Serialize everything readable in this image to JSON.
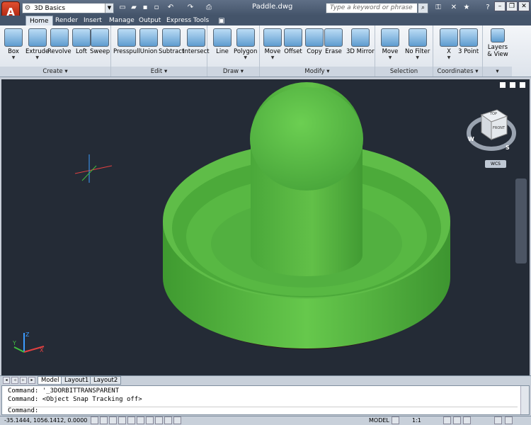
{
  "app": {
    "logo_letter": "A",
    "document_title": "Paddle.dwg"
  },
  "quick_access": {
    "workspace": "3D Basics"
  },
  "search": {
    "placeholder": "Type a keyword or phrase"
  },
  "tabs": [
    "Home",
    "Render",
    "Insert",
    "Manage",
    "Output",
    "Express Tools"
  ],
  "ribbon": {
    "panels": [
      {
        "title": "Create",
        "tools": [
          "Box",
          "Extrude",
          "Revolve",
          "Loft",
          "Sweep"
        ]
      },
      {
        "title": "Edit",
        "tools": [
          "Presspull",
          "Union",
          "Subtract",
          "Intersect"
        ]
      },
      {
        "title": "Draw",
        "tools": [
          "Line",
          "Polygon"
        ]
      },
      {
        "title": "Modify",
        "tools": [
          "Move",
          "Offset",
          "Copy",
          "Erase",
          "3D Mirror"
        ]
      },
      {
        "title": "Selection",
        "tools": [
          "Move",
          "No Filter"
        ]
      },
      {
        "title": "Coordinates",
        "tools": [
          "X",
          "3 Point"
        ]
      },
      {
        "title": "",
        "tools": [
          "Layers & View"
        ]
      }
    ]
  },
  "viewcube": {
    "top": "TOP",
    "front": "FRONT",
    "compass_w": "W",
    "compass_s": "S",
    "wcs": "WCS"
  },
  "model": {
    "color": "#5fbd48"
  },
  "layout_tabs": [
    "Model",
    "Layout1",
    "Layout2"
  ],
  "command": {
    "history": [
      "Command:  '_3DORBITTRANSPARENT",
      "Command:  <Object Snap Tracking off>"
    ],
    "prompt": "Command:"
  },
  "status": {
    "coordinates": "-35.1444, 1056.1412, 0.0000",
    "space": "MODEL",
    "scale": "1:1"
  }
}
